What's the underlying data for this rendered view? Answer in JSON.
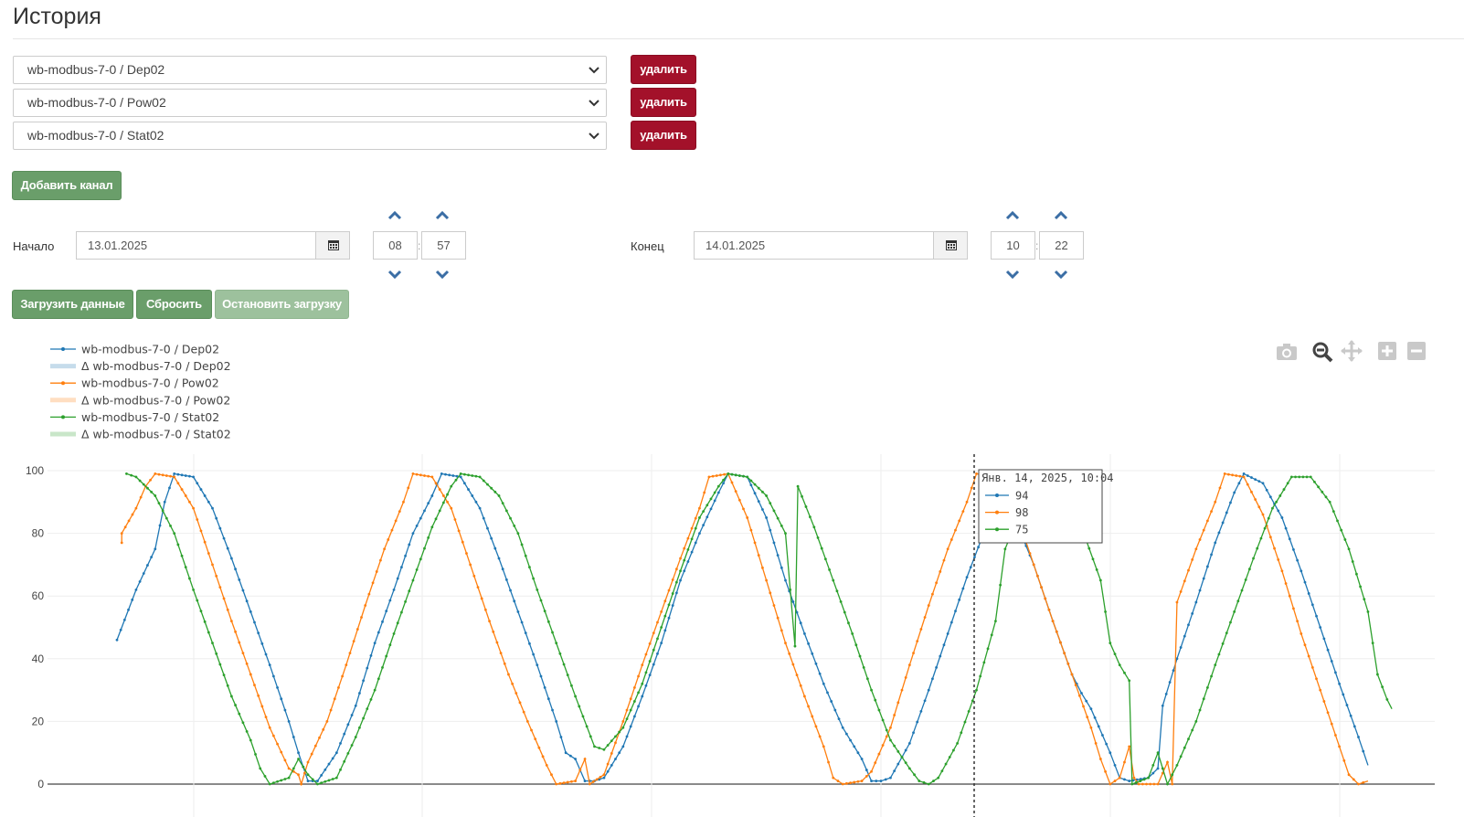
{
  "page": {
    "title": "История"
  },
  "channels": [
    {
      "value": "wb-modbus-7-0 / Dep02",
      "delete_label": "удалить"
    },
    {
      "value": "wb-modbus-7-0 / Pow02",
      "delete_label": "удалить"
    },
    {
      "value": "wb-modbus-7-0 / Stat02",
      "delete_label": "удалить"
    }
  ],
  "add_channel_label": "Добавить канал",
  "start": {
    "label": "Начало",
    "date": "13.01.2025",
    "hour": "08",
    "minute": "57"
  },
  "end": {
    "label": "Конец",
    "date": "14.01.2025",
    "hour": "10",
    "minute": "22"
  },
  "actions": {
    "load": "Загрузить данные",
    "reset": "Сбросить",
    "stop": "Остановить загрузку"
  },
  "toolbar_icons": [
    "camera-icon",
    "zoom-icon",
    "pan-icon",
    "zoom-in-icon",
    "zoom-out-icon"
  ],
  "colors": {
    "danger": "#a3112a",
    "success": "#6a9e6a",
    "dep": "#1f77b4",
    "pow": "#ff7f0e",
    "stat": "#2ca02c"
  },
  "chart_data": {
    "type": "line",
    "legend": [
      "wb-modbus-7-0 / Dep02",
      "Δ wb-modbus-7-0 / Dep02",
      "wb-modbus-7-0 / Pow02",
      "Δ wb-modbus-7-0 / Pow02",
      "wb-modbus-7-0 / Stat02",
      "Δ wb-modbus-7-0 / Stat02"
    ],
    "legend_position": "top-left",
    "yticks": [
      "0",
      "20",
      "40",
      "60",
      "80",
      "100"
    ],
    "ylim": [
      0,
      100
    ],
    "grid": true,
    "series": [
      {
        "name": "wb-modbus-7-0 / Dep02",
        "color": "#1f77b4",
        "points": [
          [
            0,
            46
          ],
          [
            2,
            62
          ],
          [
            4,
            75
          ],
          [
            5,
            90
          ],
          [
            6,
            99
          ],
          [
            8,
            98
          ],
          [
            10,
            88
          ],
          [
            12,
            72
          ],
          [
            14,
            55
          ],
          [
            16,
            38
          ],
          [
            18,
            20
          ],
          [
            19,
            10
          ],
          [
            20,
            1
          ],
          [
            21,
            1
          ],
          [
            23,
            10
          ],
          [
            25,
            25
          ],
          [
            27,
            45
          ],
          [
            29,
            62
          ],
          [
            31,
            80
          ],
          [
            33,
            92
          ],
          [
            34,
            99
          ],
          [
            36,
            98
          ],
          [
            38,
            88
          ],
          [
            40,
            72
          ],
          [
            42,
            55
          ],
          [
            44,
            38
          ],
          [
            46,
            20
          ],
          [
            47,
            10
          ],
          [
            48,
            8
          ],
          [
            49,
            1
          ],
          [
            50,
            1
          ],
          [
            51,
            2
          ],
          [
            53,
            12
          ],
          [
            55,
            28
          ],
          [
            57,
            45
          ],
          [
            59,
            65
          ],
          [
            61,
            80
          ],
          [
            63,
            93
          ],
          [
            64,
            99
          ],
          [
            66,
            98
          ],
          [
            68,
            85
          ],
          [
            70,
            65
          ],
          [
            72,
            48
          ],
          [
            74,
            32
          ],
          [
            76,
            18
          ],
          [
            78,
            8
          ],
          [
            79,
            1
          ],
          [
            80,
            1
          ],
          [
            81,
            2
          ],
          [
            83,
            13
          ],
          [
            85,
            30
          ],
          [
            87,
            48
          ],
          [
            89,
            66
          ],
          [
            91,
            82
          ],
          [
            92,
            94
          ],
          [
            94,
            85
          ],
          [
            96,
            70
          ],
          [
            98,
            52
          ],
          [
            100,
            35
          ],
          [
            101,
            29
          ],
          [
            102,
            24
          ],
          [
            104,
            10
          ],
          [
            105,
            2
          ],
          [
            106,
            1
          ],
          [
            108,
            2
          ],
          [
            109,
            5
          ],
          [
            109.5,
            25
          ],
          [
            111,
            40
          ],
          [
            113,
            58
          ],
          [
            115,
            77
          ],
          [
            117,
            93
          ],
          [
            118,
            99
          ],
          [
            120,
            96
          ],
          [
            122,
            85
          ],
          [
            124,
            68
          ],
          [
            126,
            50
          ],
          [
            128,
            32
          ],
          [
            130,
            15
          ],
          [
            131,
            6
          ]
        ]
      },
      {
        "name": "wb-modbus-7-0 / Pow02",
        "color": "#ff7f0e",
        "points": [
          [
            0.5,
            77
          ],
          [
            0.5,
            80
          ],
          [
            2,
            88
          ],
          [
            3,
            95
          ],
          [
            4,
            99
          ],
          [
            6,
            98
          ],
          [
            8,
            88
          ],
          [
            10,
            70
          ],
          [
            12,
            52
          ],
          [
            14,
            35
          ],
          [
            16,
            18
          ],
          [
            18,
            5
          ],
          [
            19,
            3
          ],
          [
            19.3,
            0
          ],
          [
            20,
            7
          ],
          [
            22,
            20
          ],
          [
            24,
            38
          ],
          [
            26,
            57
          ],
          [
            28,
            75
          ],
          [
            30,
            90
          ],
          [
            31,
            99
          ],
          [
            33,
            98
          ],
          [
            35,
            88
          ],
          [
            37,
            70
          ],
          [
            39,
            52
          ],
          [
            41,
            35
          ],
          [
            43,
            20
          ],
          [
            45,
            6
          ],
          [
            46,
            0
          ],
          [
            48,
            1
          ],
          [
            49,
            8
          ],
          [
            49.5,
            0
          ],
          [
            51,
            3
          ],
          [
            53,
            20
          ],
          [
            55,
            38
          ],
          [
            57,
            55
          ],
          [
            59,
            72
          ],
          [
            61,
            88
          ],
          [
            62,
            98
          ],
          [
            64,
            99
          ],
          [
            66,
            85
          ],
          [
            68,
            65
          ],
          [
            70,
            45
          ],
          [
            72,
            28
          ],
          [
            74,
            12
          ],
          [
            75,
            2
          ],
          [
            76,
            0
          ],
          [
            78,
            1
          ],
          [
            79,
            4
          ],
          [
            81,
            18
          ],
          [
            83,
            38
          ],
          [
            85,
            57
          ],
          [
            87,
            75
          ],
          [
            89,
            90
          ],
          [
            90,
            99
          ],
          [
            92,
            98
          ],
          [
            94,
            88
          ],
          [
            96,
            70
          ],
          [
            98,
            52
          ],
          [
            100,
            35
          ],
          [
            102,
            18
          ],
          [
            103,
            8
          ],
          [
            104,
            0
          ],
          [
            105,
            2
          ],
          [
            106,
            12
          ],
          [
            106.5,
            2
          ],
          [
            107,
            0
          ],
          [
            109,
            0
          ],
          [
            110,
            7
          ],
          [
            110.5,
            0
          ],
          [
            111,
            58
          ],
          [
            113,
            75
          ],
          [
            115,
            90
          ],
          [
            116,
            99
          ],
          [
            118,
            98
          ],
          [
            120,
            86
          ],
          [
            122,
            68
          ],
          [
            124,
            48
          ],
          [
            126,
            30
          ],
          [
            128,
            12
          ],
          [
            129,
            3
          ],
          [
            130,
            0
          ],
          [
            131,
            1
          ]
        ]
      },
      {
        "name": "wb-modbus-7-0 / Stat02",
        "color": "#2ca02c",
        "points": [
          [
            1,
            99
          ],
          [
            2,
            98
          ],
          [
            4,
            92
          ],
          [
            6,
            80
          ],
          [
            8,
            62
          ],
          [
            10,
            45
          ],
          [
            12,
            28
          ],
          [
            14,
            14
          ],
          [
            15,
            5
          ],
          [
            16,
            0
          ],
          [
            18,
            2
          ],
          [
            19,
            8
          ],
          [
            20,
            3
          ],
          [
            21,
            0
          ],
          [
            23,
            2
          ],
          [
            25,
            15
          ],
          [
            27,
            30
          ],
          [
            29,
            48
          ],
          [
            31,
            65
          ],
          [
            33,
            82
          ],
          [
            35,
            95
          ],
          [
            36,
            99
          ],
          [
            38,
            98
          ],
          [
            40,
            92
          ],
          [
            42,
            80
          ],
          [
            44,
            62
          ],
          [
            46,
            45
          ],
          [
            48,
            28
          ],
          [
            50,
            12
          ],
          [
            51,
            11
          ],
          [
            53,
            18
          ],
          [
            55,
            32
          ],
          [
            57,
            50
          ],
          [
            59,
            68
          ],
          [
            61,
            85
          ],
          [
            63,
            95
          ],
          [
            64,
            99
          ],
          [
            66,
            98
          ],
          [
            68,
            92
          ],
          [
            70,
            80
          ],
          [
            71,
            44
          ],
          [
            71.3,
            95
          ],
          [
            73,
            82
          ],
          [
            75,
            65
          ],
          [
            77,
            48
          ],
          [
            79,
            30
          ],
          [
            81,
            14
          ],
          [
            83,
            5
          ],
          [
            84,
            1
          ],
          [
            85,
            0
          ],
          [
            86,
            2
          ],
          [
            88,
            13
          ],
          [
            90,
            30
          ],
          [
            92,
            52
          ],
          [
            93,
            75
          ],
          [
            95,
            90
          ],
          [
            97,
            99
          ],
          [
            99,
            95
          ],
          [
            101,
            82
          ],
          [
            103,
            65
          ],
          [
            104,
            45
          ],
          [
            105,
            38
          ],
          [
            106,
            33
          ],
          [
            106.3,
            0
          ],
          [
            108,
            2
          ],
          [
            109,
            10
          ],
          [
            110,
            0
          ],
          [
            111,
            6
          ],
          [
            113,
            20
          ],
          [
            115,
            38
          ],
          [
            117,
            55
          ],
          [
            119,
            72
          ],
          [
            121,
            88
          ],
          [
            123,
            98
          ],
          [
            125,
            98
          ],
          [
            127,
            90
          ],
          [
            129,
            75
          ],
          [
            131,
            55
          ],
          [
            132,
            35
          ],
          [
            133,
            27
          ],
          [
            133.5,
            24
          ]
        ]
      }
    ],
    "tooltip": {
      "title": "Янв. 14, 2025, 10:04",
      "entries": [
        {
          "value": "94",
          "color": "#1f77b4"
        },
        {
          "value": "98",
          "color": "#ff7f0e"
        },
        {
          "value": "75",
          "color": "#2ca02c"
        }
      ]
    }
  }
}
